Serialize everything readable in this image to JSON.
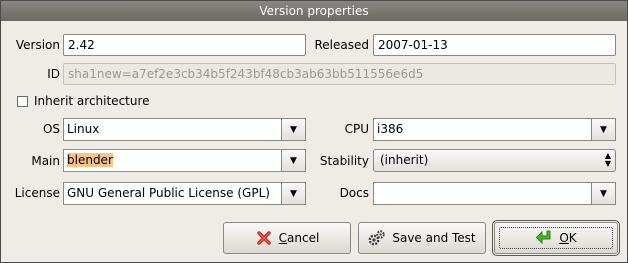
{
  "window": {
    "title": "Version properties"
  },
  "labels": {
    "version": "Version",
    "released": "Released",
    "id": "ID",
    "inherit": "Inherit architecture",
    "os": "OS",
    "cpu": "CPU",
    "main": "Main",
    "stability": "Stability",
    "license": "License",
    "docs": "Docs"
  },
  "values": {
    "version": "2.42",
    "released": "2007-01-13",
    "id": "sha1new=a7ef2e3cb34b5f243bf48cb3ab63bb511556e6d5",
    "inherit_checked": false,
    "os": "Linux",
    "cpu": "i386",
    "main": "blender",
    "stability": "(inherit)",
    "license": "GNU General Public License (GPL)",
    "docs": ""
  },
  "buttons": {
    "cancel_u": "C",
    "cancel_rest": "ancel",
    "save_test": "Save and Test",
    "ok_u": "O",
    "ok_rest": "K"
  },
  "icons": {
    "cancel": "red-x-icon",
    "save_test": "gears-icon",
    "ok": "green-check-arrow-icon",
    "dropdown": "down-triangle-icon",
    "spin": "up-down-arrows-icon"
  },
  "colors": {
    "titlebar": "#77736e",
    "main_highlight": "#f7c48a",
    "focus_border": "#e37a2c"
  }
}
